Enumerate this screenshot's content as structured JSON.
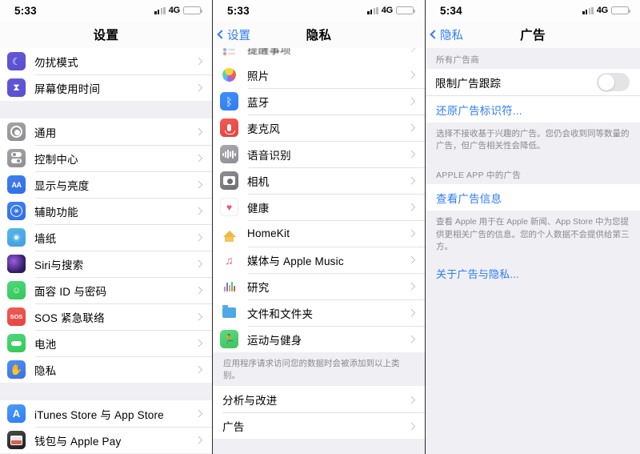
{
  "screens": [
    {
      "id": "settings",
      "status": {
        "time": "5:33",
        "network": "4G",
        "battery_level_pct": 38
      },
      "nav": {
        "title": "设置",
        "back_label": null
      },
      "groups": [
        {
          "rows": [
            {
              "icon": "moon-icon",
              "label": "勿扰模式"
            },
            {
              "icon": "hourglass-icon",
              "label": "屏幕使用时间"
            }
          ]
        },
        {
          "rows": [
            {
              "icon": "gear-icon",
              "label": "通用"
            },
            {
              "icon": "control-center-icon",
              "label": "控制中心"
            },
            {
              "icon": "display-brightness-icon",
              "label": "显示与亮度"
            },
            {
              "icon": "accessibility-icon",
              "label": "辅助功能"
            },
            {
              "icon": "wallpaper-icon",
              "label": "墙纸"
            },
            {
              "icon": "siri-icon",
              "label": "Siri与搜索"
            },
            {
              "icon": "face-id-icon",
              "label": "面容 ID 与密码"
            },
            {
              "icon": "sos-icon",
              "label": "SOS 紧急联络"
            },
            {
              "icon": "battery-icon",
              "label": "电池"
            },
            {
              "icon": "privacy-hand-icon",
              "label": "隐私"
            }
          ]
        },
        {
          "rows": [
            {
              "icon": "app-store-icon",
              "label": "iTunes Store 与 App Store"
            },
            {
              "icon": "wallet-icon",
              "label": "钱包与 Apple Pay"
            }
          ]
        }
      ]
    },
    {
      "id": "privacy",
      "status": {
        "time": "5:33",
        "network": "4G",
        "battery_level_pct": 38
      },
      "nav": {
        "title": "隐私",
        "back_label": "设置"
      },
      "cut_row": {
        "icon": "reminders-icon",
        "label": "提醒事项"
      },
      "groups": [
        {
          "rows": [
            {
              "icon": "photos-icon",
              "label": "照片"
            },
            {
              "icon": "bluetooth-icon",
              "label": "蓝牙"
            },
            {
              "icon": "microphone-icon",
              "label": "麦克风"
            },
            {
              "icon": "speech-recognition-icon",
              "label": "语音识别"
            },
            {
              "icon": "camera-icon",
              "label": "相机"
            },
            {
              "icon": "health-icon",
              "label": "健康"
            },
            {
              "icon": "homekit-icon",
              "label": "HomeKit"
            },
            {
              "icon": "music-icon",
              "label": "媒体与 Apple Music"
            },
            {
              "icon": "research-icon",
              "label": "研究"
            },
            {
              "icon": "files-icon",
              "label": "文件和文件夹"
            },
            {
              "icon": "fitness-icon",
              "label": "运动与健身"
            }
          ]
        }
      ],
      "footnote": "应用程序请求访问您的数据时会被添加到以上类别。",
      "bottom_rows": [
        {
          "label": "分析与改进"
        },
        {
          "label": "广告"
        }
      ]
    },
    {
      "id": "advertising",
      "status": {
        "time": "5:34",
        "network": "4G",
        "battery_level_pct": 38
      },
      "nav": {
        "title": "广告",
        "back_label": "隐私"
      },
      "section_header": "所有广告商",
      "toggle_row": {
        "label": "限制广告跟踪",
        "on": false
      },
      "reset_link": "还原广告标识符...",
      "toggle_footnote": "选择不接收基于兴趣的广告。您仍会收到同等数量的广告，但广告相关性会降低。",
      "section_header_2": "APPLE APP 中的广告",
      "view_ad_link": "查看广告信息",
      "view_ad_footnote": "查看 Apple 用于在 Apple 新闻、App Store 中为您提供更相关广告的信息。您的个人数据不会提供给第三方。",
      "about_link": "关于广告与隐私..."
    }
  ],
  "colors": {
    "accent_blue": "#2f7cf6",
    "group_bg": "#efeff4",
    "row_bg": "#ffffff",
    "separator": "#e2e2e4",
    "secondary_text": "#8a8a8e",
    "battery_yellow": "#f3c52c"
  }
}
